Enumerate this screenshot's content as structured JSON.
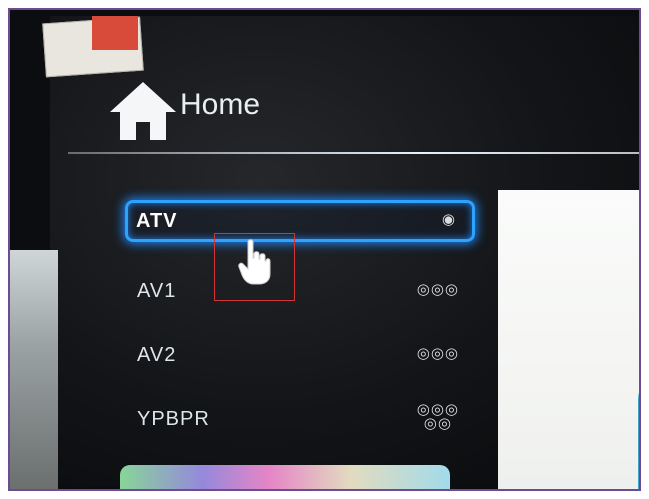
{
  "header": {
    "title": "Home",
    "icon": "home-icon"
  },
  "sources": [
    {
      "label": "ATV",
      "icon": "antenna-connector-icon",
      "selected": true
    },
    {
      "label": "AV1",
      "icon": "composite-connector-icon",
      "selected": false
    },
    {
      "label": "AV2",
      "icon": "composite-connector-icon",
      "selected": false
    },
    {
      "label": "YPBPR",
      "icon": "component-connector-icon",
      "selected": false
    }
  ],
  "colors": {
    "accent": "#2ea2ff",
    "frame": "#6d4a91",
    "highlight_box": "#d33434"
  }
}
